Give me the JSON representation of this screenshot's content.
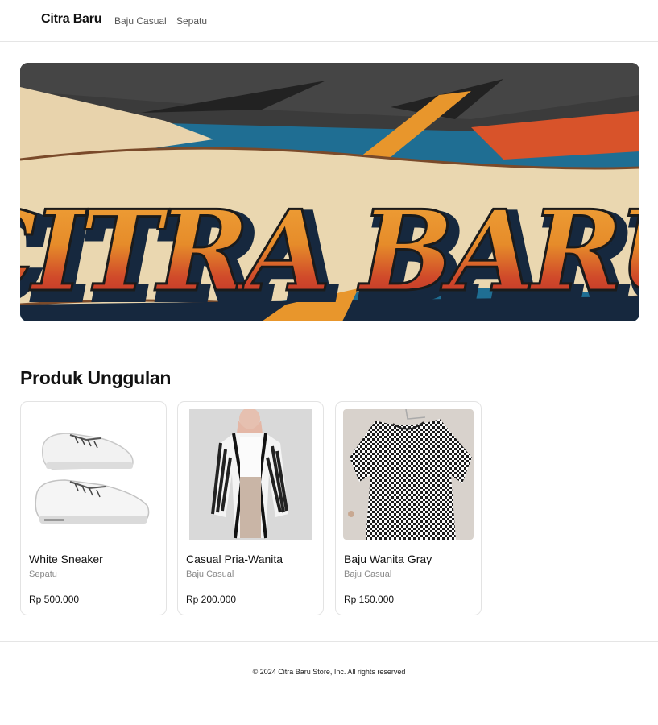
{
  "nav": {
    "brand": "Citra Baru",
    "links": [
      {
        "label": "Baju Casual"
      },
      {
        "label": "Sepatu"
      }
    ]
  },
  "hero": {
    "banner_text": "CITRA BARU"
  },
  "featured": {
    "title": "Produk Unggulan",
    "products": [
      {
        "name": "White Sneaker",
        "category": "Sepatu",
        "price": "Rp 500.000"
      },
      {
        "name": "Casual Pria-Wanita",
        "category": "Baju Casual",
        "price": "Rp 200.000"
      },
      {
        "name": "Baju Wanita Gray",
        "category": "Baju Casual",
        "price": "Rp 150.000"
      }
    ]
  },
  "footer": {
    "copyright": "© 2024 Citra Baru Store, Inc. All rights reserved"
  },
  "colors": {
    "banner_orange": "#e8962c",
    "banner_red": "#c8322b",
    "banner_blue": "#1f6e93",
    "banner_navy": "#16283e"
  }
}
